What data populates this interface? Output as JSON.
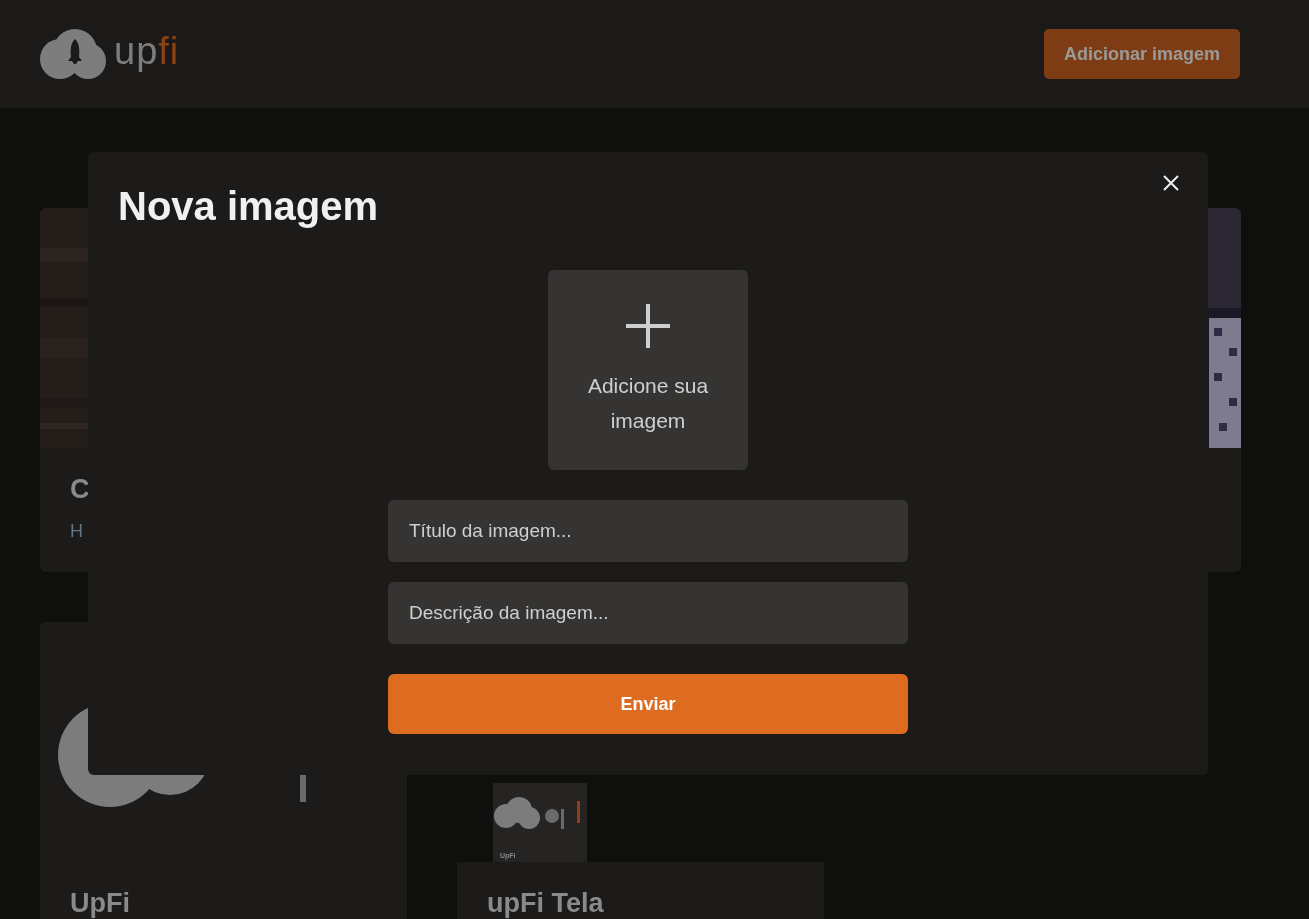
{
  "header": {
    "logo": {
      "parts": [
        {
          "text": "up",
          "color": "#7d7d7d"
        },
        {
          "text": "fi",
          "color": "#8a4113"
        }
      ]
    },
    "add_button": "Adicionar imagem"
  },
  "cards": [
    {
      "title": "C",
      "description": "H",
      "kind": "picture"
    },
    {
      "kind": "picture"
    },
    {
      "title": "UpFi",
      "kind": "picture"
    },
    {
      "title": "upFi Tela",
      "kind": "picture",
      "caption": "UpFi"
    }
  ],
  "modal": {
    "title": "Nova imagem",
    "upload": {
      "label": "Adicione sua imagem"
    },
    "fields": [
      {
        "placeholder": "Título da imagem..."
      },
      {
        "placeholder": "Descrição da imagem..."
      }
    ],
    "submit": "Enviar"
  }
}
